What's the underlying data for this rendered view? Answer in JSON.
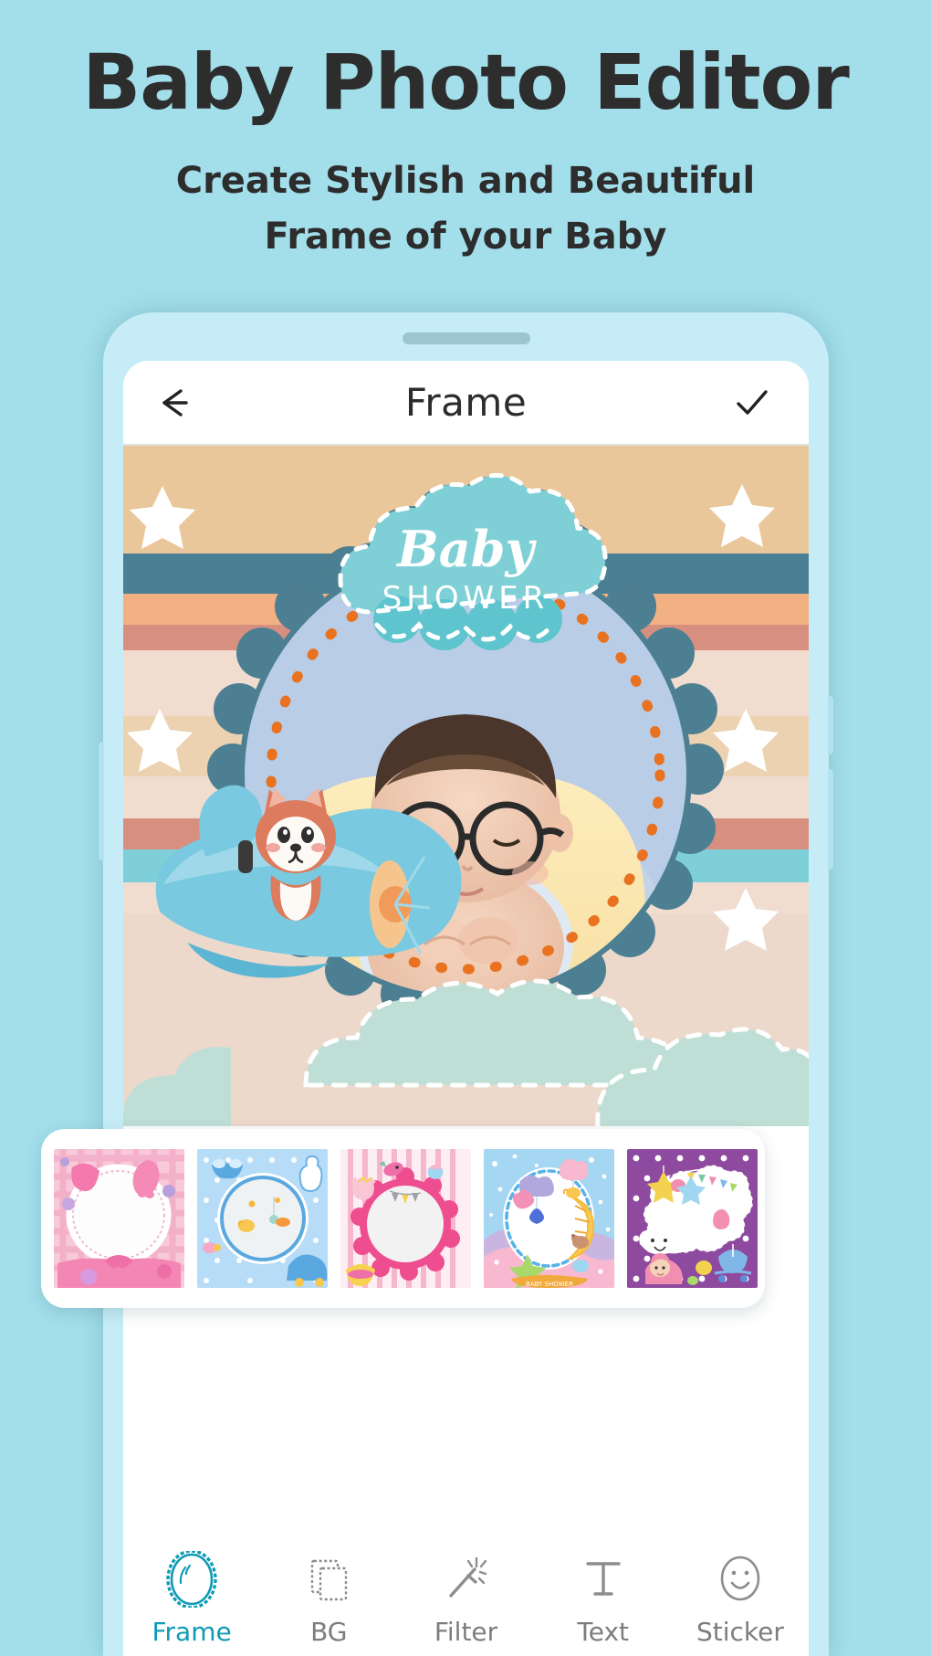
{
  "promo": {
    "title": "Baby Photo Editor",
    "subtitle_line1": "Create Stylish and Beautiful",
    "subtitle_line2": "Frame of your Baby",
    "background_color": "#a2dfeb",
    "text_color": "#2d2d2d"
  },
  "phone": {
    "body_color": "#c6edf7",
    "screen_color": "#ffffff"
  },
  "appbar": {
    "back_icon": "arrow-left-icon",
    "title": "Frame",
    "done_icon": "check-icon",
    "title_color": "#2c2c2c"
  },
  "canvas": {
    "frame_name": "Baby Shower Frame",
    "cloud_label_line1": "Baby",
    "cloud_label_line2": "SHOWER",
    "stripes": [
      {
        "color": "#e9c79a",
        "label": "tan-top-band"
      },
      {
        "color": "#4b7f93",
        "label": "teal-stripe"
      },
      {
        "color": "#f2b183",
        "label": "orange-stripe"
      },
      {
        "color": "#d79080",
        "label": "rose-stripe"
      },
      {
        "color": "#f0ddd0",
        "label": "cream-stripe"
      },
      {
        "color": "#ecd2b0",
        "label": "sand-stripe"
      },
      {
        "color": "#7fcfd8",
        "label": "aqua-stripe"
      }
    ],
    "scallop_color": "#4d7f93",
    "photo_bg_color": "#b9cde6",
    "dotted_arc_color": "#e8721f",
    "cloud_color": "#7fd0d6",
    "star_color": "#ffffff",
    "stickers": [
      "fox-in-airplane-sticker",
      "cloud-sticker",
      "star-sticker"
    ]
  },
  "carousel": {
    "selected_index": 0,
    "thumbnails": [
      {
        "name": "pink-gingham-frame",
        "bg": "#f6c3d4",
        "accent": "#ef7fae"
      },
      {
        "name": "blue-polkadot-frame",
        "bg": "#b8dcf5",
        "accent": "#5aa8e0"
      },
      {
        "name": "pink-stripe-frame",
        "bg": "#f9ccd8",
        "accent": "#ef4d8e"
      },
      {
        "name": "moon-sky-frame",
        "bg": "#a8d9f2",
        "accent": "#f6c760"
      },
      {
        "name": "purple-dots-frame",
        "bg": "#8e4a9e",
        "accent": "#ffffff"
      }
    ]
  },
  "bottom_nav": {
    "active_color": "#0f9bb5",
    "inactive_color": "#7d7d7d",
    "items": [
      {
        "label": "Frame",
        "icon": "oval-scallop-frame-icon",
        "active": true
      },
      {
        "label": "BG",
        "icon": "layers-background-icon",
        "active": false
      },
      {
        "label": "Filter",
        "icon": "magic-wand-icon",
        "active": false
      },
      {
        "label": "Text",
        "icon": "text-t-icon",
        "active": false
      },
      {
        "label": "Sticker",
        "icon": "smiley-face-icon",
        "active": false
      }
    ]
  }
}
